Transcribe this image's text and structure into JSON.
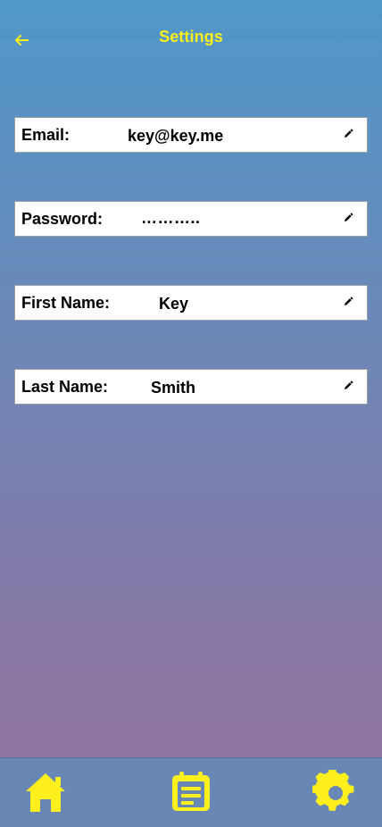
{
  "header": {
    "title": "Settings",
    "back_icon": "back-arrow-icon",
    "accent_color": "#ffef1d"
  },
  "settings": {
    "email": {
      "label": "Email:",
      "value": "key@key.me",
      "edit_icon": "edit-pencil-icon"
    },
    "password": {
      "label": "Password:",
      "value": "………..",
      "edit_icon": "edit-pencil-icon"
    },
    "first_name": {
      "label": "First Name:",
      "value": "Key",
      "edit_icon": "edit-pencil-icon"
    },
    "last_name": {
      "label": "Last Name:",
      "value": "Smith",
      "edit_icon": "edit-pencil-icon"
    }
  },
  "bottom_nav": {
    "items": [
      {
        "name": "home-icon"
      },
      {
        "name": "notes-icon"
      },
      {
        "name": "settings-icon"
      }
    ]
  }
}
